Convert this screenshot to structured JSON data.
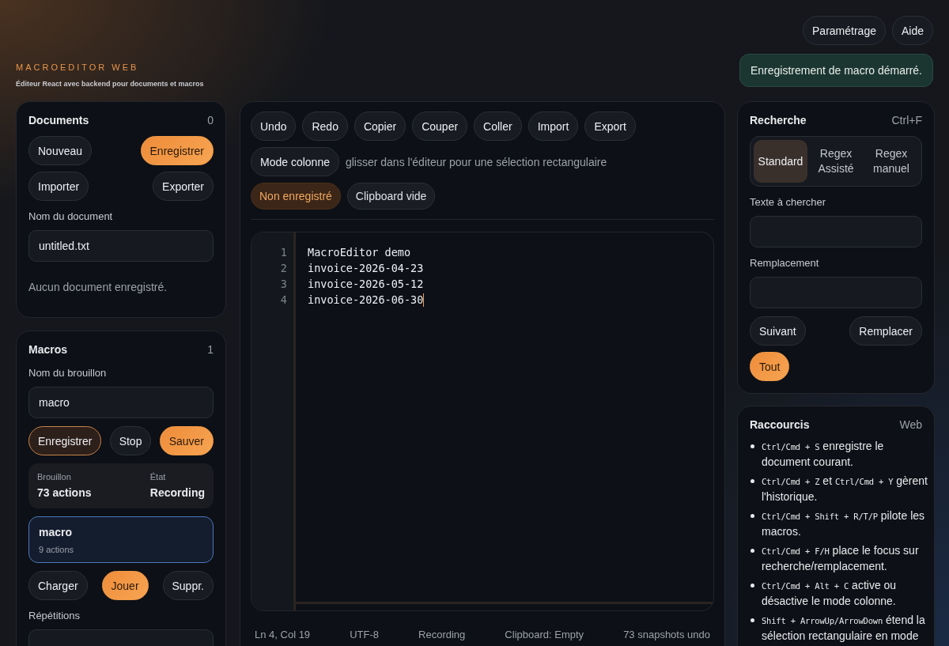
{
  "header": {
    "brand": "MACROEDITOR WEB",
    "subtitle": "Éditeur React avec backend pour documents et macros",
    "actions": [
      {
        "label": "Paramétrage"
      },
      {
        "label": "Aide"
      }
    ],
    "toast": "Enregistrement de macro démarré."
  },
  "documents": {
    "title": "Documents",
    "count": "0",
    "buttons": [
      {
        "label": "Nouveau",
        "kind": "default"
      },
      {
        "label": "Enregistrer",
        "kind": "primary"
      },
      {
        "label": "Importer",
        "kind": "default"
      },
      {
        "label": "Exporter",
        "kind": "default"
      }
    ],
    "field_label": "Nom du document",
    "field_value": "untitled.txt",
    "empty": "Aucun document enregistré."
  },
  "macros": {
    "title": "Macros",
    "count": "1",
    "field_label": "Nom du brouillon",
    "field_value": "macro",
    "buttons": [
      {
        "label": "Enregistrer",
        "kind": "recording"
      },
      {
        "label": "Stop",
        "kind": "default"
      },
      {
        "label": "Sauver",
        "kind": "primary"
      }
    ],
    "draft": {
      "label": "Brouillon",
      "value": "73 actions",
      "state_label": "État",
      "state_value": "Recording"
    },
    "items": [
      {
        "name": "macro",
        "meta": "9 actions",
        "selected": true
      }
    ],
    "item_buttons": [
      {
        "label": "Charger",
        "kind": "default"
      },
      {
        "label": "Jouer",
        "kind": "primary"
      },
      {
        "label": "Suppr.",
        "kind": "default"
      }
    ],
    "repeat_label": "Répétitions"
  },
  "editor": {
    "toolbar": [
      {
        "label": "Undo"
      },
      {
        "label": "Redo"
      },
      {
        "label": "Copier"
      },
      {
        "label": "Couper"
      },
      {
        "label": "Coller"
      },
      {
        "label": "Import"
      },
      {
        "label": "Export"
      }
    ],
    "column_mode": {
      "label": "Mode colonne",
      "on": false,
      "hint": "glisser dans l'éditeur pour une sélection rectangulaire"
    },
    "pills": [
      {
        "label": "Non enregistré",
        "kind": "warning"
      },
      {
        "label": "Clipboard vide",
        "kind": "neutral"
      }
    ],
    "lines": [
      {
        "number": "1",
        "text": "MacroEditor demo",
        "cursor": false
      },
      {
        "number": "2",
        "text": "invoice-2026-04-23",
        "cursor": false
      },
      {
        "number": "3",
        "text": "invoice-2026-05-12",
        "cursor": false
      },
      {
        "number": "4",
        "text": "invoice-2026-06-30",
        "cursor": true
      }
    ],
    "status_bar": [
      "Ln 4, Col 19",
      "UTF-8",
      "Recording",
      "Clipboard: Empty",
      "73 snapshots undo"
    ]
  },
  "search": {
    "title": "Recherche",
    "shortcut": "Ctrl+F",
    "modes": [
      {
        "label": "Standard",
        "selected": true
      },
      {
        "label": "Regex Assisté",
        "selected": false
      },
      {
        "label": "Regex manuel",
        "selected": false
      }
    ],
    "find_label": "Texte à chercher",
    "replace_label": "Remplacement",
    "buttons": [
      {
        "label": "Suivant",
        "kind": "default"
      },
      {
        "label": "Remplacer",
        "kind": "default"
      },
      {
        "label": "Tout",
        "kind": "primary"
      }
    ]
  },
  "shortcuts": {
    "title": "Raccourcis",
    "tag": "Web",
    "items": [
      [
        {
          "kind": "code",
          "text": "Ctrl/Cmd + S"
        },
        {
          "kind": "text",
          "text": " enregistre le document courant."
        }
      ],
      [
        {
          "kind": "code",
          "text": "Ctrl/Cmd + Z"
        },
        {
          "kind": "text",
          "text": " et "
        },
        {
          "kind": "code",
          "text": "Ctrl/Cmd + Y"
        },
        {
          "kind": "text",
          "text": " gèrent l'historique."
        }
      ],
      [
        {
          "kind": "code",
          "text": "Ctrl/Cmd + Shift + R/T/P"
        },
        {
          "kind": "text",
          "text": " pilote les macros."
        }
      ],
      [
        {
          "kind": "code",
          "text": "Ctrl/Cmd + F/H"
        },
        {
          "kind": "text",
          "text": " place le focus sur recherche/remplacement."
        }
      ],
      [
        {
          "kind": "code",
          "text": "Ctrl/Cmd + Alt + C"
        },
        {
          "kind": "text",
          "text": " active ou désactive le mode colonne."
        }
      ],
      [
        {
          "kind": "code",
          "text": "Shift + ArrowUp/ArrowDown"
        },
        {
          "kind": "text",
          "text": " étend la sélection rectangulaire en mode"
        }
      ]
    ]
  }
}
